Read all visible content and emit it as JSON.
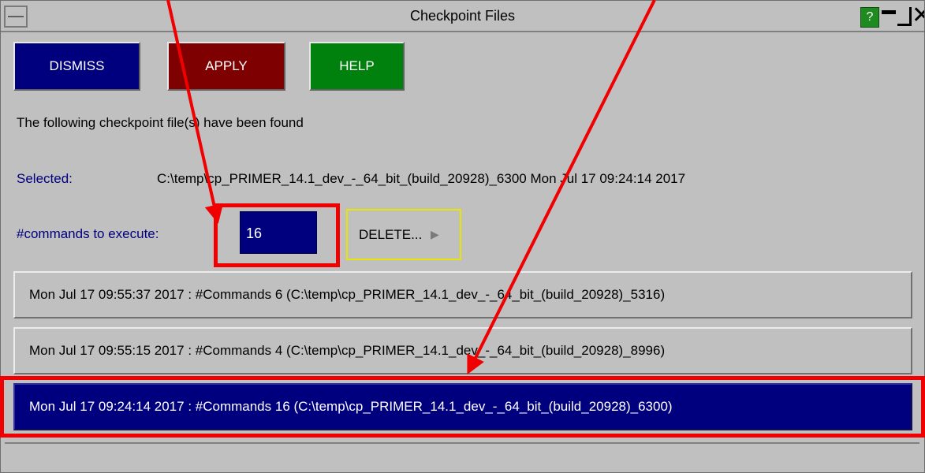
{
  "window": {
    "title": "Checkpoint Files",
    "help_icon_label": "?",
    "close_glyph": "✕"
  },
  "toolbar": {
    "dismiss_label": "DISMISS",
    "apply_label": "APPLY",
    "help_label": "HELP"
  },
  "message": "The following checkpoint file(s) have been found",
  "selected": {
    "label": "Selected:",
    "value": "C:\\temp\\cp_PRIMER_14.1_dev_-_64_bit_(build_20928)_6300 Mon Jul 17 09:24:14 2017"
  },
  "commands": {
    "label": "#commands to execute:",
    "value": "16"
  },
  "delete_label": "DELETE...",
  "delete_icon": "flag-icon",
  "checkpoints": [
    {
      "label": "Mon Jul 17 09:55:37 2017 : #Commands 6  (C:\\temp\\cp_PRIMER_14.1_dev_-_64_bit_(build_20928)_5316)",
      "selected": false
    },
    {
      "label": "Mon Jul 17 09:55:15 2017 : #Commands 4  (C:\\temp\\cp_PRIMER_14.1_dev_-_64_bit_(build_20928)_8996)",
      "selected": false
    },
    {
      "label": "Mon Jul 17 09:24:14 2017 : #Commands 16  (C:\\temp\\cp_PRIMER_14.1_dev_-_64_bit_(build_20928)_6300)",
      "selected": true
    }
  ],
  "colors": {
    "window_bg": "#c0c0c0",
    "dismiss": "#00007f",
    "apply": "#7f0000",
    "help": "#00800c",
    "selected_row": "#00007f",
    "annotation": "#f00000",
    "delete_outline": "#e6e600"
  }
}
